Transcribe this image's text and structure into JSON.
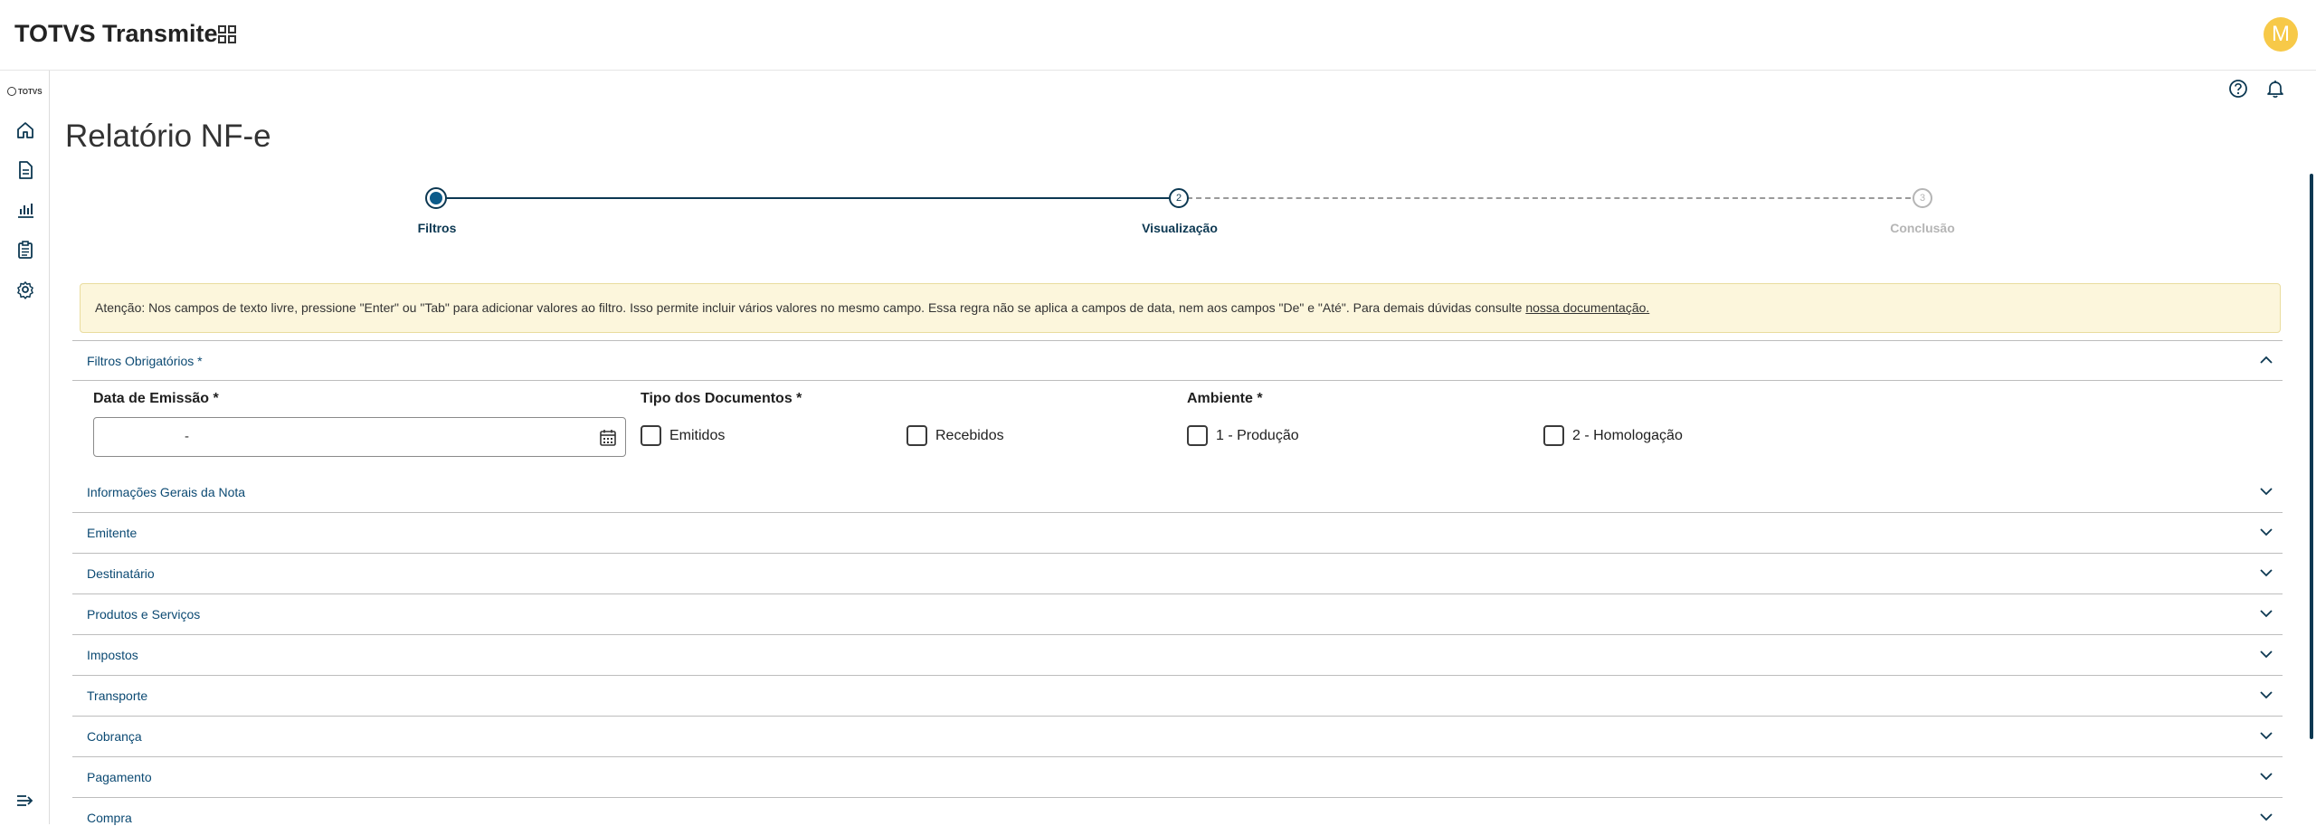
{
  "app": {
    "title": "TOTVS Transmite",
    "avatar_initial": "M",
    "logo_text": "TOTVS"
  },
  "page": {
    "title": "Relatório NF-e"
  },
  "stepper": {
    "steps": [
      {
        "number": "",
        "label": "Filtros",
        "state": "active"
      },
      {
        "number": "2",
        "label": "Visualização",
        "state": "current"
      },
      {
        "number": "3",
        "label": "Conclusão",
        "state": "pending"
      }
    ]
  },
  "alert": {
    "text": "Atenção: Nos campos de texto livre, pressione \"Enter\" ou \"Tab\" para adicionar valores ao filtro. Isso permite incluir vários valores no mesmo campo. Essa regra não se aplica a campos de data, nem aos campos \"De\" e \"Até\". Para demais dúvidas consulte ",
    "link": "nossa documentação."
  },
  "filters_required": {
    "title": "Filtros Obrigatórios *",
    "date_label": "Data de Emissão *",
    "date_separator": "-",
    "doc_type_label": "Tipo dos Documentos *",
    "doc_types": [
      "Emitidos",
      "Recebidos"
    ],
    "env_label": "Ambiente *",
    "environments": [
      "1 - Produção",
      "2 - Homologação"
    ]
  },
  "sections": [
    "Informações Gerais da Nota",
    "Emitente",
    "Destinatário",
    "Produtos e Serviços",
    "Impostos",
    "Transporte",
    "Cobrança",
    "Pagamento",
    "Compra"
  ],
  "colors": {
    "primary": "#0c3852",
    "link": "#0c4a73",
    "alert_bg": "#fcf6dc",
    "avatar": "#f7c948"
  }
}
